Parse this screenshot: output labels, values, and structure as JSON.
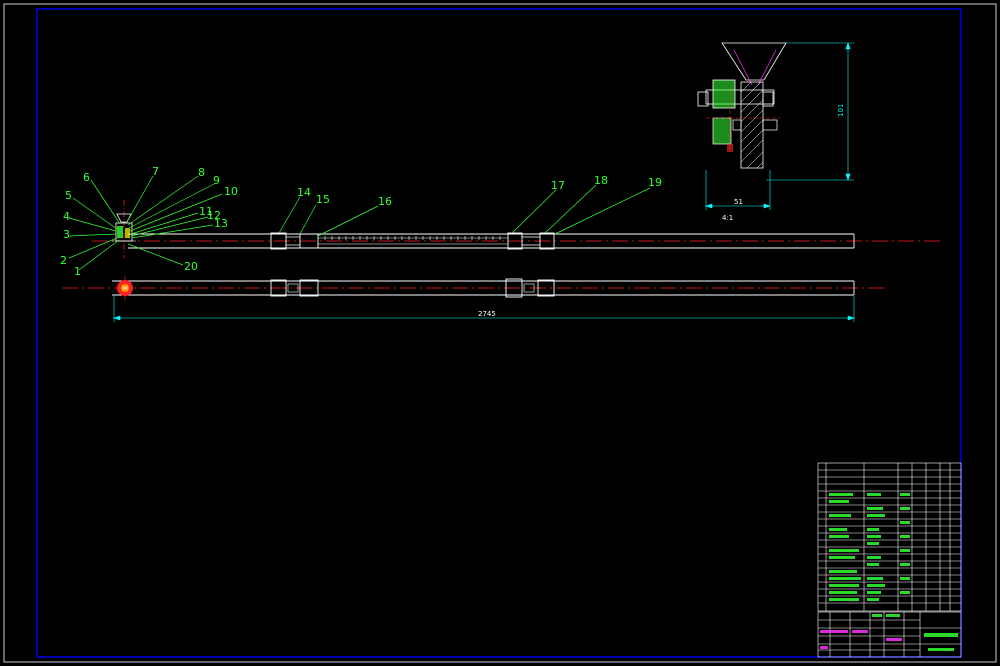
{
  "balloons": [
    "1",
    "2",
    "3",
    "4",
    "5",
    "6",
    "7",
    "8",
    "9",
    "10",
    "11",
    "12",
    "13",
    "14",
    "15",
    "16",
    "17",
    "18",
    "19",
    "20"
  ],
  "dimensions": {
    "overall_length": "2745",
    "detail_width": "51",
    "detail_height": "101"
  },
  "detail_scale": "4:1",
  "colors": {
    "frame": "#0000ff",
    "outline": "#ffffff",
    "centerline": "#ff2020",
    "leader": "#33ff33",
    "dimension": "#00ffff",
    "hatch": "#33ff33",
    "hopper": "#ff33ff"
  }
}
